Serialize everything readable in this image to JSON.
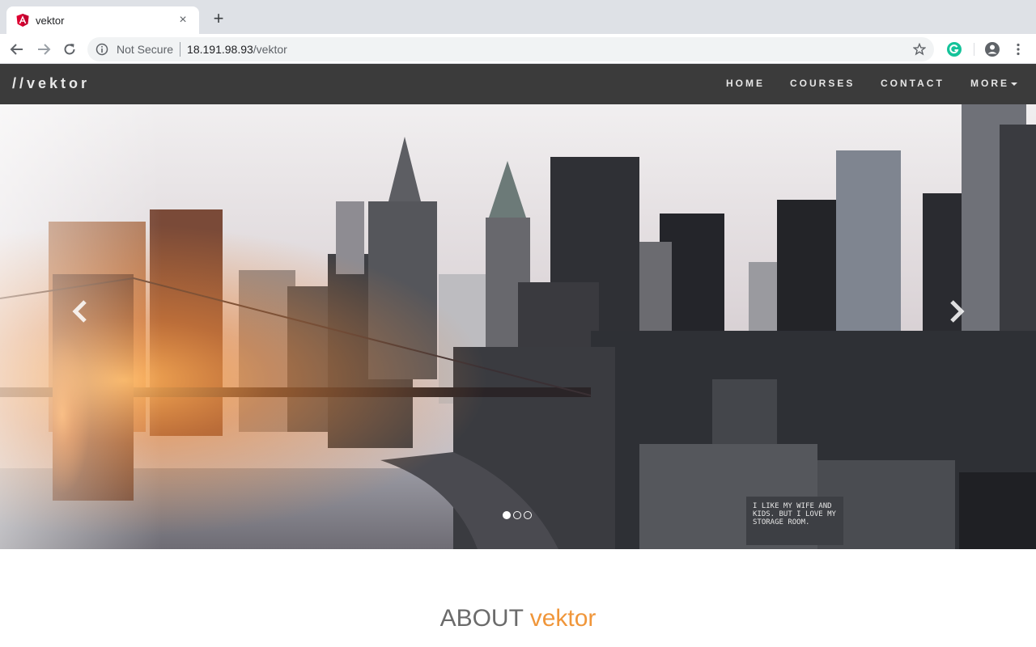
{
  "browser": {
    "tab_title": "vektor",
    "tab_close": "×",
    "new_tab": "+",
    "security_label": "Not Secure",
    "url_host": "18.191.98.93",
    "url_path": "/vektor"
  },
  "site": {
    "brand": "//vektor",
    "nav": {
      "home": "HOME",
      "courses": "COURSES",
      "contact": "CONTACT",
      "more": "MORE"
    }
  },
  "hero": {
    "billboard_text": "I LIKE MY WIFE AND KIDS. BUT I LOVE MY STORAGE ROOM.",
    "slide_count": 3,
    "active_slide": 1
  },
  "about": {
    "word1": "ABOUT",
    "word2": "vektor"
  },
  "colors": {
    "nav_bg": "#3b3b3b",
    "accent": "#f0963a"
  }
}
